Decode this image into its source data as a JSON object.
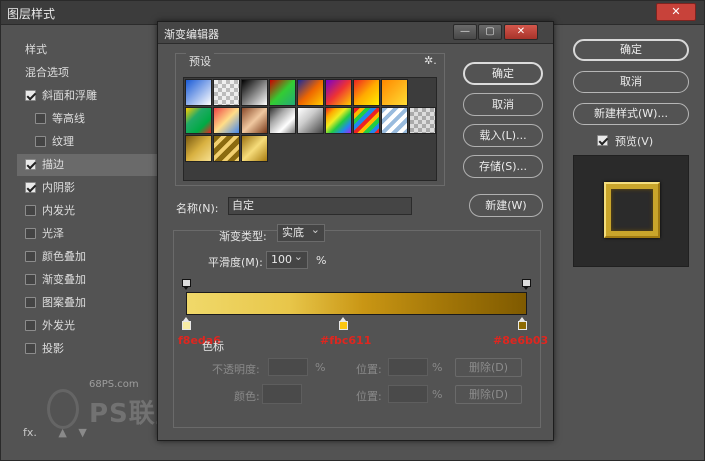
{
  "layer_style": {
    "title": "图层样式",
    "close": "✕",
    "styles_label": "样式",
    "items": [
      {
        "label": "混合选项",
        "check": "none"
      },
      {
        "label": "斜面和浮雕",
        "check": "on"
      },
      {
        "label": "等高线",
        "check": "off",
        "indent": true
      },
      {
        "label": "纹理",
        "check": "off",
        "indent": true
      },
      {
        "label": "描边",
        "check": "on",
        "active": true
      },
      {
        "label": "内阴影",
        "check": "on"
      },
      {
        "label": "内发光",
        "check": "off"
      },
      {
        "label": "光泽",
        "check": "off"
      },
      {
        "label": "颜色叠加",
        "check": "off"
      },
      {
        "label": "渐变叠加",
        "check": "off"
      },
      {
        "label": "图案叠加",
        "check": "off"
      },
      {
        "label": "外发光",
        "check": "off"
      },
      {
        "label": "投影",
        "check": "off"
      }
    ],
    "buttons": {
      "ok": "确定",
      "cancel": "取消",
      "new_style": "新建样式(W)..."
    },
    "preview_label": "预览(V)",
    "fx": "fx.",
    "watermark": {
      "site": "68PS.com",
      "logo": "PS联盟"
    }
  },
  "gradient_editor": {
    "title": "渐变编辑器",
    "presets_label": "预设",
    "gear": "✲.",
    "buttons": {
      "ok": "确定",
      "cancel": "取消",
      "load": "载入(L)...",
      "save": "存储(S)...",
      "new": "新建(W)"
    },
    "name_label": "名称(N):",
    "name_value": "自定",
    "gradient_type_label": "渐变类型:",
    "gradient_type_value": "实底",
    "smoothness_label": "平滑度(M):",
    "smoothness_value": "100",
    "smoothness_unit": "%",
    "color_stops": [
      {
        "hex": "#f8eda6",
        "label": "f8eda6",
        "position": 0
      },
      {
        "hex": "#fbc611",
        "label": "#fbc611",
        "position": 46
      },
      {
        "hex": "#8e6b03",
        "label": "#8e6b03",
        "position": 100
      }
    ],
    "color_stop_label": "色标",
    "fields": {
      "opacity_label": "不透明度:",
      "opacity_unit": "%",
      "location_label": "位置:",
      "location_unit": "%",
      "delete": "删除(D)",
      "color_label": "颜色:"
    }
  },
  "colors": {
    "panel_bg": "#535353",
    "title_bg": "#3c3c3c",
    "close_red": "#c8423a",
    "annotation_red": "#e0261f"
  }
}
